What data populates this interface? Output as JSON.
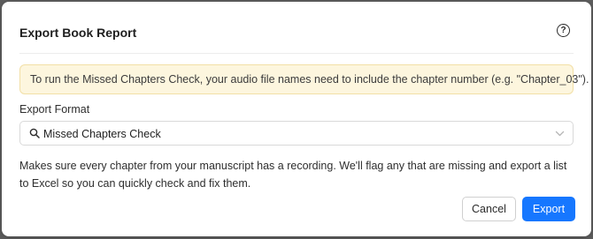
{
  "dialog": {
    "title": "Export Book Report",
    "help_icon": "question-circle-icon",
    "help_glyph": "?"
  },
  "notice": {
    "text": "To run the Missed Chapters Check, your audio file names need to include the chapter number (e.g. \"Chapter_03\").",
    "background_color": "#fdf6de"
  },
  "export_format": {
    "label": "Export Format",
    "selected_value": "Missed Chapters Check",
    "leading_icon": "search-icon",
    "trailing_icon": "chevron-down-icon"
  },
  "description": "Makes sure every chapter from your manuscript has a recording. We'll flag any that are missing and export a list to Excel so you can quickly check and fix them.",
  "footer": {
    "cancel_label": "Cancel",
    "export_label": "Export",
    "primary_color": "#1677ff"
  }
}
